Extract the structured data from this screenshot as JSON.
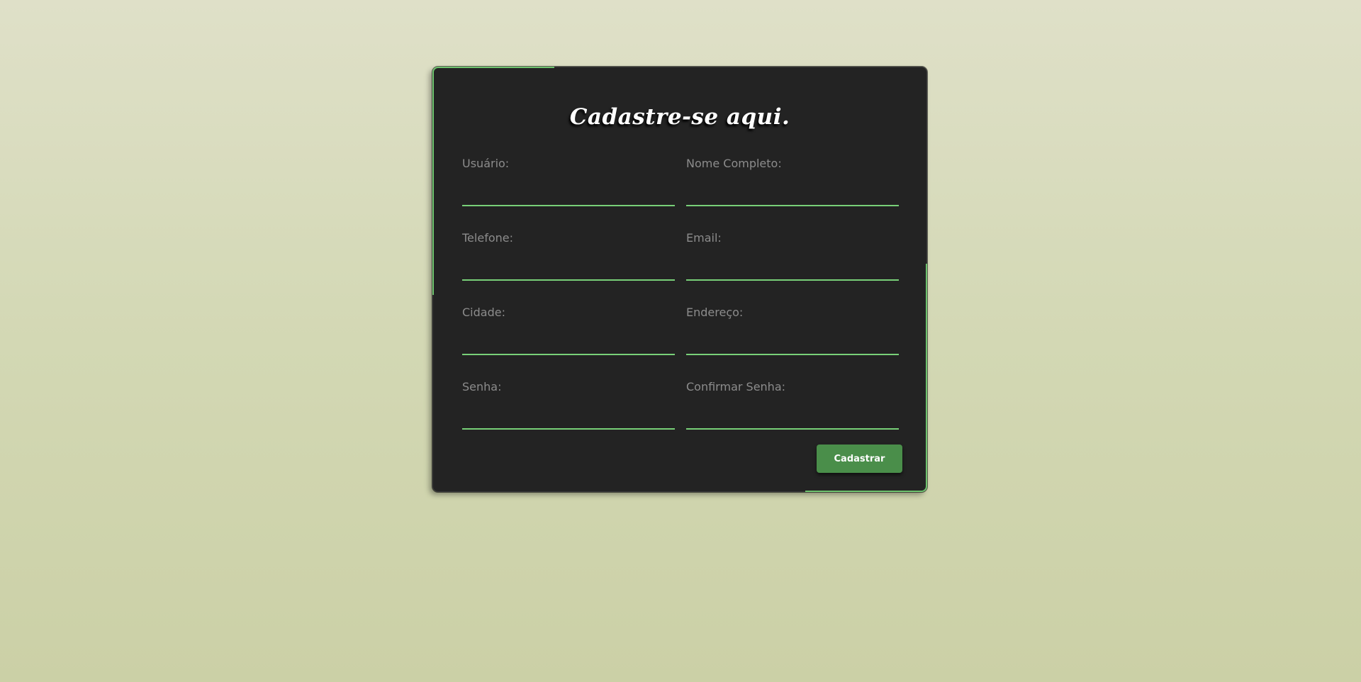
{
  "form": {
    "title": "Cadastre-se aqui.",
    "fields": [
      {
        "label": "Usuário:",
        "value": ""
      },
      {
        "label": "Nome Completo:",
        "value": ""
      },
      {
        "label": "Telefone:",
        "value": ""
      },
      {
        "label": "Email:",
        "value": ""
      },
      {
        "label": "Cidade:",
        "value": ""
      },
      {
        "label": "Endereço:",
        "value": ""
      },
      {
        "label": "Senha:",
        "value": ""
      },
      {
        "label": "Confirmar Senha:",
        "value": ""
      }
    ],
    "submit_label": "Cadastrar"
  },
  "colors": {
    "accent": "#6fc46f",
    "button": "#4a8e4a",
    "card_background": "#232323",
    "page_background_top": "#dfe0c8",
    "page_background_bottom": "#cbd0a6"
  }
}
